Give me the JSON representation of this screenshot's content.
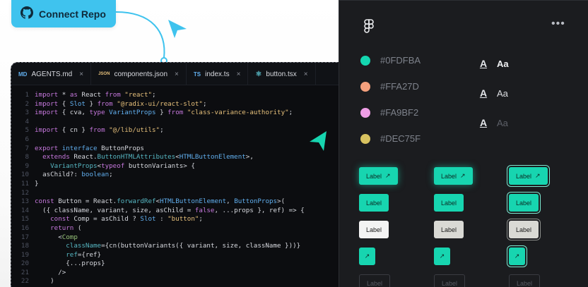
{
  "connect": {
    "label": "Connect Repo",
    "icon": "github-icon"
  },
  "tabs": [
    {
      "icon_text": "MD",
      "icon_color": "#61afef",
      "label": "AGENTS.md"
    },
    {
      "icon_text": "JSON",
      "icon_color": "#e6c07b",
      "label": "components.json"
    },
    {
      "icon_text": "TS",
      "icon_color": "#61afef",
      "label": "index.ts"
    },
    {
      "icon_text": "⚛",
      "icon_color": "#56b6c2",
      "label": "button.tsx"
    }
  ],
  "tab_close": "×",
  "code": {
    "lines": [
      [
        [
          "kw",
          "import"
        ],
        [
          "lc",
          " * "
        ],
        [
          "kw",
          "as"
        ],
        [
          "lc",
          " React "
        ],
        [
          "kw",
          "from"
        ],
        [
          "st",
          " \"react\""
        ],
        [
          "lc",
          ";"
        ]
      ],
      [
        [
          "kw",
          "import"
        ],
        [
          "lc",
          " { "
        ],
        [
          "ty",
          "Slot"
        ],
        [
          "lc",
          " } "
        ],
        [
          "kw",
          "from"
        ],
        [
          "st",
          " \"@radix-ui/react-slot\""
        ],
        [
          "lc",
          ";"
        ]
      ],
      [
        [
          "kw",
          "import"
        ],
        [
          "lc",
          " { cva, "
        ],
        [
          "kw",
          "type"
        ],
        [
          "ty",
          " VariantProps"
        ],
        [
          "lc",
          " } "
        ],
        [
          "kw",
          "from"
        ],
        [
          "st",
          " \"class-variance-authority\""
        ],
        [
          "lc",
          ";"
        ]
      ],
      [],
      [
        [
          "kw",
          "import"
        ],
        [
          "lc",
          " { cn } "
        ],
        [
          "kw",
          "from"
        ],
        [
          "st",
          " \"@/lib/utils\""
        ],
        [
          "lc",
          ";"
        ]
      ],
      [],
      [
        [
          "kw",
          "export"
        ],
        [
          "ty",
          " interface"
        ],
        [
          "lc",
          " ButtonProps"
        ]
      ],
      [
        [
          "lc",
          "  "
        ],
        [
          "kw",
          "extends"
        ],
        [
          "lc",
          " React."
        ],
        [
          "fn",
          "ButtonHTMLAttributes"
        ],
        [
          "lc",
          "<"
        ],
        [
          "ty",
          "HTMLButtonElement"
        ],
        [
          "lc",
          ">,"
        ]
      ],
      [
        [
          "lc",
          "    "
        ],
        [
          "fn",
          "VariantProps"
        ],
        [
          "lc",
          "<"
        ],
        [
          "kw",
          "typeof"
        ],
        [
          "lc",
          " buttonVariants> {"
        ]
      ],
      [
        [
          "lc",
          "  asChild?: "
        ],
        [
          "ty",
          "boolean"
        ],
        [
          "lc",
          ";"
        ]
      ],
      [
        [
          "lc",
          "}"
        ]
      ],
      [],
      [
        [
          "kw",
          "const"
        ],
        [
          "lc",
          " Button = React."
        ],
        [
          "fn",
          "forwardRef"
        ],
        [
          "lc",
          "<"
        ],
        [
          "ty",
          "HTMLButtonElement"
        ],
        [
          "lc",
          ", "
        ],
        [
          "ty",
          "ButtonProps"
        ],
        [
          "lc",
          ">("
        ]
      ],
      [
        [
          "lc",
          "  ({ className, variant, size, asChild = "
        ],
        [
          "kw",
          "false"
        ],
        [
          "lc",
          ", ...props }, ref) => {"
        ]
      ],
      [
        [
          "lc",
          "    "
        ],
        [
          "kw",
          "const"
        ],
        [
          "lc",
          " Comp = asChild ? "
        ],
        [
          "ty",
          "Slot"
        ],
        [
          "lc",
          " : "
        ],
        [
          "st",
          "\"button\""
        ],
        [
          "lc",
          ";"
        ]
      ],
      [
        [
          "lc",
          "    "
        ],
        [
          "kw",
          "return"
        ],
        [
          "lc",
          " ("
        ]
      ],
      [
        [
          "lc",
          "      <"
        ],
        [
          "at",
          "Comp"
        ]
      ],
      [
        [
          "lc",
          "        "
        ],
        [
          "fn",
          "className"
        ],
        [
          "lc",
          "={cn(buttonVariants({ variant, size, className }))}"
        ]
      ],
      [
        [
          "lc",
          "        "
        ],
        [
          "fn",
          "ref"
        ],
        [
          "lc",
          "={ref}"
        ]
      ],
      [
        [
          "lc",
          "        {...props}"
        ]
      ],
      [
        [
          "lc",
          "      />"
        ]
      ],
      [
        [
          "lc",
          "    )"
        ]
      ]
    ]
  },
  "panel": {
    "logo": "figma-logo",
    "more": "•••",
    "colors": [
      {
        "hex": "#0FDFBA",
        "dot": "#14d6b0"
      },
      {
        "hex": "#FFA27D",
        "dot": "#f4a07d"
      },
      {
        "hex": "#FA9BF2",
        "dot": "#ef9ee6"
      },
      {
        "hex": "#DEC75F",
        "dot": "#d8c260"
      }
    ],
    "fonts": [
      {
        "glyph": "A",
        "sample": "Aa",
        "color": "#f1f2f4",
        "weight": "bold"
      },
      {
        "glyph": "A",
        "sample": "Aa",
        "color": "#dcdee2",
        "weight": "normal"
      },
      {
        "glyph": "A",
        "sample": "Aa",
        "color": "#5d6068",
        "weight": "normal"
      }
    ],
    "button_label": "Label",
    "arrow": "↗"
  }
}
